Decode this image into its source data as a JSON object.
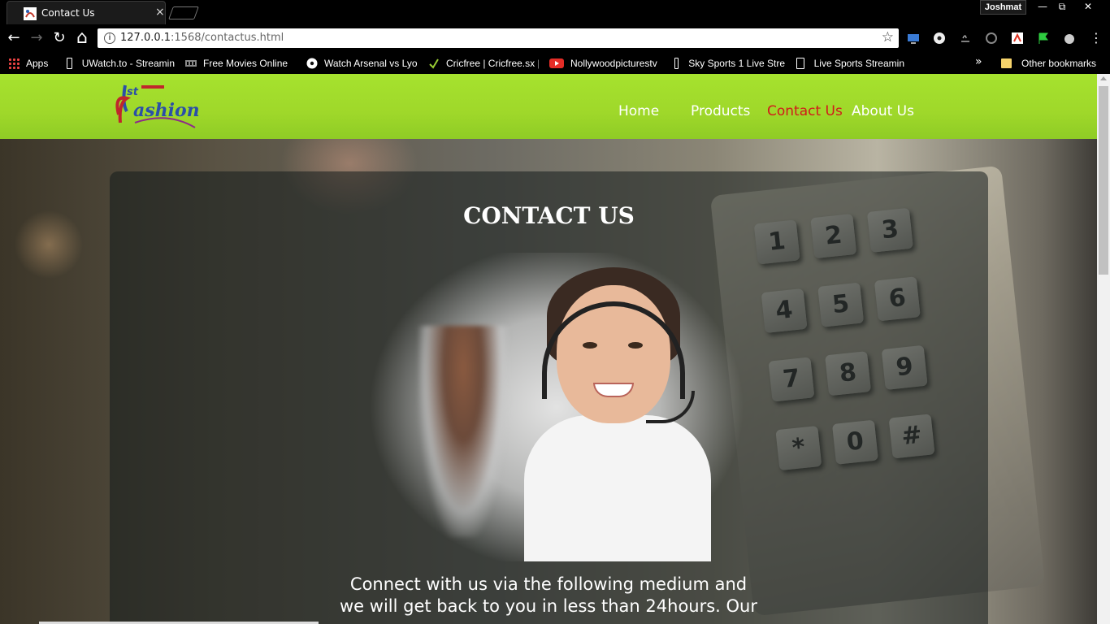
{
  "browser": {
    "tab_title": "Contact Us",
    "tab_close": "×",
    "profile_name": "Joshmat",
    "window_controls": {
      "minimize": "—",
      "restore": "⧉",
      "close": "✕"
    },
    "url_host": "127.0.0.1",
    "url_rest": ":1568/contactus.html",
    "nav": {
      "back": "←",
      "forward": "→",
      "reload": "↻",
      "home": "⌂"
    },
    "star": "☆"
  },
  "bookmarks": {
    "items": [
      {
        "label": "Apps",
        "icon": "apps-grid-icon"
      },
      {
        "label": "UWatch.to - Streamin",
        "icon": "page-icon"
      },
      {
        "label": "Free Movies Online",
        "icon": "film-icon"
      },
      {
        "label": "Watch Arsenal vs Lyo",
        "icon": "soccer-icon"
      },
      {
        "label": "Cricfree | Cricfree.sx |",
        "icon": "check-icon"
      },
      {
        "label": "Nollywoodpicturestv",
        "icon": "youtube-icon"
      },
      {
        "label": "Sky Sports 1 Live Stre",
        "icon": "page-icon"
      },
      {
        "label": "Live Sports Streamin",
        "icon": "page-icon"
      }
    ],
    "more": "»",
    "other": "Other bookmarks"
  },
  "site": {
    "nav": [
      {
        "label": "Home"
      },
      {
        "label": "Products"
      },
      {
        "label": "Contact Us",
        "active": true
      },
      {
        "label": "About Us"
      }
    ],
    "accent_color": "#a6e22e",
    "active_link_color": "#d11a1a"
  },
  "contact": {
    "title": "CONTACT US",
    "text": "Connect with us via the following medium and we will get back to you in less than 24hours. Our"
  },
  "keypad": [
    "1",
    "2",
    "3",
    "4",
    "5",
    "6",
    "7",
    "8",
    "9",
    "*",
    "0",
    "#"
  ]
}
